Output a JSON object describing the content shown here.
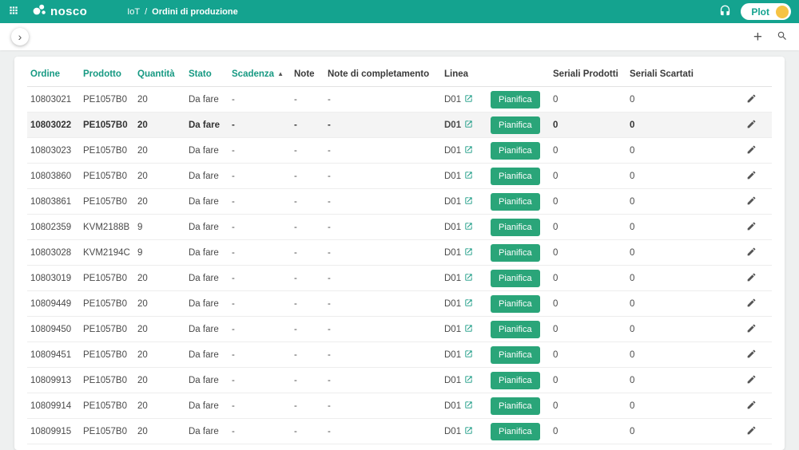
{
  "colors": {
    "topbar": "#14a38f",
    "accent": "#169982",
    "button": "#2aa579",
    "avatar": "#f6c344"
  },
  "topbar": {
    "brand": "nosco",
    "breadcrumb_section": "IoT",
    "breadcrumb_separator": "/",
    "breadcrumb_page": "Ordini di produzione",
    "plot_label": "Plot"
  },
  "toolbar": {
    "expand_glyph": "›",
    "add_glyph": "+"
  },
  "table": {
    "headers": {
      "ordine": "Ordine",
      "prodotto": "Prodotto",
      "quantita": "Quantità",
      "stato": "Stato",
      "scadenza": "Scadenza",
      "sort_glyph": "▲",
      "note": "Note",
      "note_completamento": "Note di completamento",
      "linea": "Linea",
      "seriali_prodotti": "Seriali Prodotti",
      "seriali_scartati": "Seriali Scartati"
    },
    "plan_button_label": "Pianifica",
    "rows": [
      {
        "ordine": "10803021",
        "prodotto": "PE1057B0",
        "quantita": "20",
        "stato": "Da fare",
        "scadenza": "-",
        "note": "-",
        "note_completamento": "-",
        "linea": "D01",
        "seriali_prodotti": "0",
        "seriali_scartati": "0",
        "highlighted": false
      },
      {
        "ordine": "10803022",
        "prodotto": "PE1057B0",
        "quantita": "20",
        "stato": "Da fare",
        "scadenza": "-",
        "note": "-",
        "note_completamento": "-",
        "linea": "D01",
        "seriali_prodotti": "0",
        "seriali_scartati": "0",
        "highlighted": true
      },
      {
        "ordine": "10803023",
        "prodotto": "PE1057B0",
        "quantita": "20",
        "stato": "Da fare",
        "scadenza": "-",
        "note": "-",
        "note_completamento": "-",
        "linea": "D01",
        "seriali_prodotti": "0",
        "seriali_scartati": "0",
        "highlighted": false
      },
      {
        "ordine": "10803860",
        "prodotto": "PE1057B0",
        "quantita": "20",
        "stato": "Da fare",
        "scadenza": "-",
        "note": "-",
        "note_completamento": "-",
        "linea": "D01",
        "seriali_prodotti": "0",
        "seriali_scartati": "0",
        "highlighted": false
      },
      {
        "ordine": "10803861",
        "prodotto": "PE1057B0",
        "quantita": "20",
        "stato": "Da fare",
        "scadenza": "-",
        "note": "-",
        "note_completamento": "-",
        "linea": "D01",
        "seriali_prodotti": "0",
        "seriali_scartati": "0",
        "highlighted": false
      },
      {
        "ordine": "10802359",
        "prodotto": "KVM2188B",
        "quantita": "9",
        "stato": "Da fare",
        "scadenza": "-",
        "note": "-",
        "note_completamento": "-",
        "linea": "D01",
        "seriali_prodotti": "0",
        "seriali_scartati": "0",
        "highlighted": false
      },
      {
        "ordine": "10803028",
        "prodotto": "KVM2194C",
        "quantita": "9",
        "stato": "Da fare",
        "scadenza": "-",
        "note": "-",
        "note_completamento": "-",
        "linea": "D01",
        "seriali_prodotti": "0",
        "seriali_scartati": "0",
        "highlighted": false
      },
      {
        "ordine": "10803019",
        "prodotto": "PE1057B0",
        "quantita": "20",
        "stato": "Da fare",
        "scadenza": "-",
        "note": "-",
        "note_completamento": "-",
        "linea": "D01",
        "seriali_prodotti": "0",
        "seriali_scartati": "0",
        "highlighted": false
      },
      {
        "ordine": "10809449",
        "prodotto": "PE1057B0",
        "quantita": "20",
        "stato": "Da fare",
        "scadenza": "-",
        "note": "-",
        "note_completamento": "-",
        "linea": "D01",
        "seriali_prodotti": "0",
        "seriali_scartati": "0",
        "highlighted": false
      },
      {
        "ordine": "10809450",
        "prodotto": "PE1057B0",
        "quantita": "20",
        "stato": "Da fare",
        "scadenza": "-",
        "note": "-",
        "note_completamento": "-",
        "linea": "D01",
        "seriali_prodotti": "0",
        "seriali_scartati": "0",
        "highlighted": false
      },
      {
        "ordine": "10809451",
        "prodotto": "PE1057B0",
        "quantita": "20",
        "stato": "Da fare",
        "scadenza": "-",
        "note": "-",
        "note_completamento": "-",
        "linea": "D01",
        "seriali_prodotti": "0",
        "seriali_scartati": "0",
        "highlighted": false
      },
      {
        "ordine": "10809913",
        "prodotto": "PE1057B0",
        "quantita": "20",
        "stato": "Da fare",
        "scadenza": "-",
        "note": "-",
        "note_completamento": "-",
        "linea": "D01",
        "seriali_prodotti": "0",
        "seriali_scartati": "0",
        "highlighted": false
      },
      {
        "ordine": "10809914",
        "prodotto": "PE1057B0",
        "quantita": "20",
        "stato": "Da fare",
        "scadenza": "-",
        "note": "-",
        "note_completamento": "-",
        "linea": "D01",
        "seriali_prodotti": "0",
        "seriali_scartati": "0",
        "highlighted": false
      },
      {
        "ordine": "10809915",
        "prodotto": "PE1057B0",
        "quantita": "20",
        "stato": "Da fare",
        "scadenza": "-",
        "note": "-",
        "note_completamento": "-",
        "linea": "D01",
        "seriali_prodotti": "0",
        "seriali_scartati": "0",
        "highlighted": false
      }
    ]
  }
}
